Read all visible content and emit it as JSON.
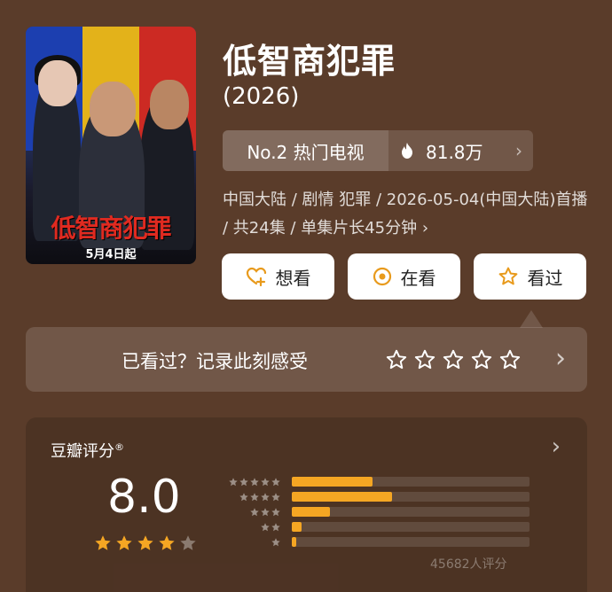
{
  "poster": {
    "title_text": "低智商犯罪",
    "date_text": "5月4日起"
  },
  "show": {
    "title": "低智商犯罪",
    "year": "(2026)"
  },
  "rank": {
    "label": "No.2 热门电视",
    "heat": "81.8万",
    "flame_icon": "flame-icon",
    "chevron": "›"
  },
  "meta": {
    "text": "中国大陆 / 剧情 犯罪 / 2026-05-04(中国大陆)首播 / 共24集 / 单集片长45分钟 ›"
  },
  "actions": {
    "want_label": "想看",
    "watching_label": "在看",
    "watched_label": "看过"
  },
  "record": {
    "prompt": "已看过？记录此刻感受",
    "star_count": 5,
    "chevron": "›"
  },
  "rating": {
    "label": "豆瓣评分",
    "registered_mark": "®",
    "score": "8.0",
    "stars_filled": 4,
    "stars_total": 5,
    "rater_count": "45682人评分",
    "chevron": "›",
    "distribution": [
      {
        "stars": 5,
        "fraction": 0.34
      },
      {
        "stars": 4,
        "fraction": 0.42
      },
      {
        "stars": 3,
        "fraction": 0.16
      },
      {
        "stars": 2,
        "fraction": 0.04
      },
      {
        "stars": 1,
        "fraction": 0.02
      }
    ]
  },
  "colors": {
    "background": "#5a3c2a",
    "accent": "#f5a623",
    "star_outline": "#ffffff"
  }
}
